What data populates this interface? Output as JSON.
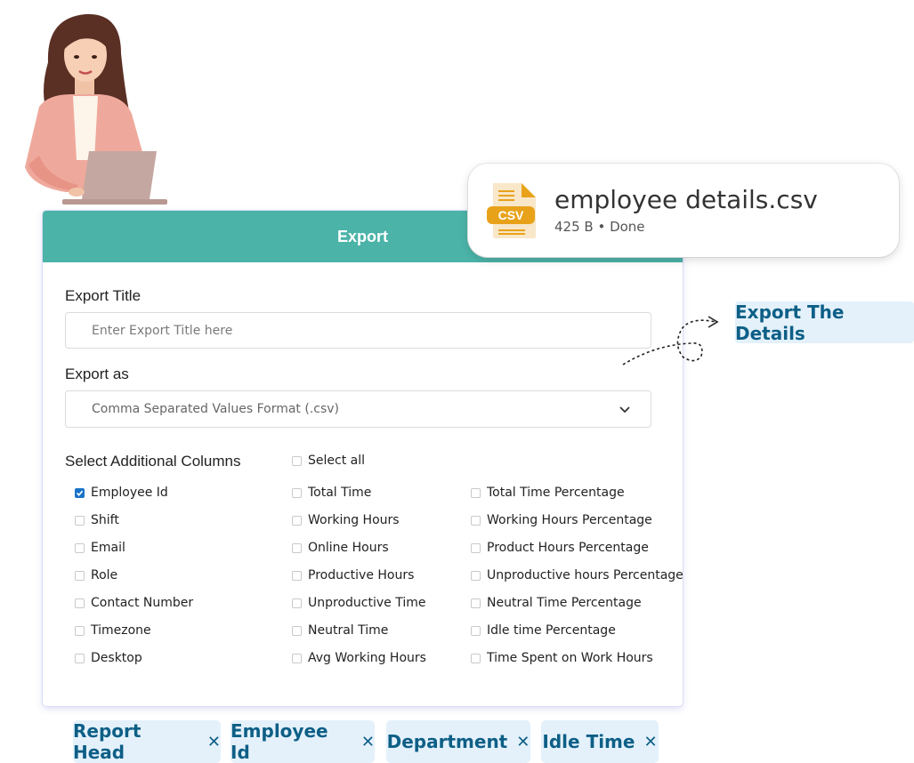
{
  "panel": {
    "title": "Export",
    "export_title_label": "Export Title",
    "export_title_placeholder": "Enter Export Title here",
    "export_as_label": "Export as",
    "export_as_value": "Comma Separated Values Format (.csv)",
    "columns_label": "Select Additional Columns",
    "select_all": "Select all"
  },
  "columns": {
    "col1": [
      {
        "label": "Employee Id",
        "checked": true
      },
      {
        "label": "Shift",
        "checked": false
      },
      {
        "label": "Email",
        "checked": false
      },
      {
        "label": "Role",
        "checked": false
      },
      {
        "label": "Contact Number",
        "checked": false
      },
      {
        "label": "Timezone",
        "checked": false
      },
      {
        "label": "Desktop",
        "checked": false
      }
    ],
    "col2": [
      {
        "label": "Total Time",
        "checked": false
      },
      {
        "label": "Working Hours",
        "checked": false
      },
      {
        "label": "Online Hours",
        "checked": false
      },
      {
        "label": "Productive Hours",
        "checked": false
      },
      {
        "label": "Unproductive Time",
        "checked": false
      },
      {
        "label": "Neutral Time",
        "checked": false
      },
      {
        "label": "Avg Working Hours",
        "checked": false
      }
    ],
    "col3": [
      {
        "label": "Total Time Percentage",
        "checked": false
      },
      {
        "label": "Working Hours Percentage",
        "checked": false
      },
      {
        "label": "Product Hours Percentage",
        "checked": false
      },
      {
        "label": "Unproductive hours Percentage",
        "checked": false
      },
      {
        "label": "Neutral Time Percentage",
        "checked": false
      },
      {
        "label": "Idle time Percentage",
        "checked": false
      },
      {
        "label": "Time Spent on Work Hours",
        "checked": false
      }
    ]
  },
  "file": {
    "name": "employee details.csv",
    "meta": "425 B • Done",
    "badge": "CSV"
  },
  "callout": "Export The Details",
  "chips": [
    "Report Head",
    "Employee Id",
    "Department",
    "Idle Time"
  ],
  "icons": {
    "chevron": "chevron-down-icon",
    "file": "csv-file-icon",
    "check": "check-icon",
    "close": "close-icon"
  },
  "colors": {
    "header": "#4bb3a8",
    "accent": "#0d5f86",
    "chip_bg": "#e4f1fb",
    "checkbox": "#1a73c9",
    "csv_orange": "#e8a21a"
  }
}
